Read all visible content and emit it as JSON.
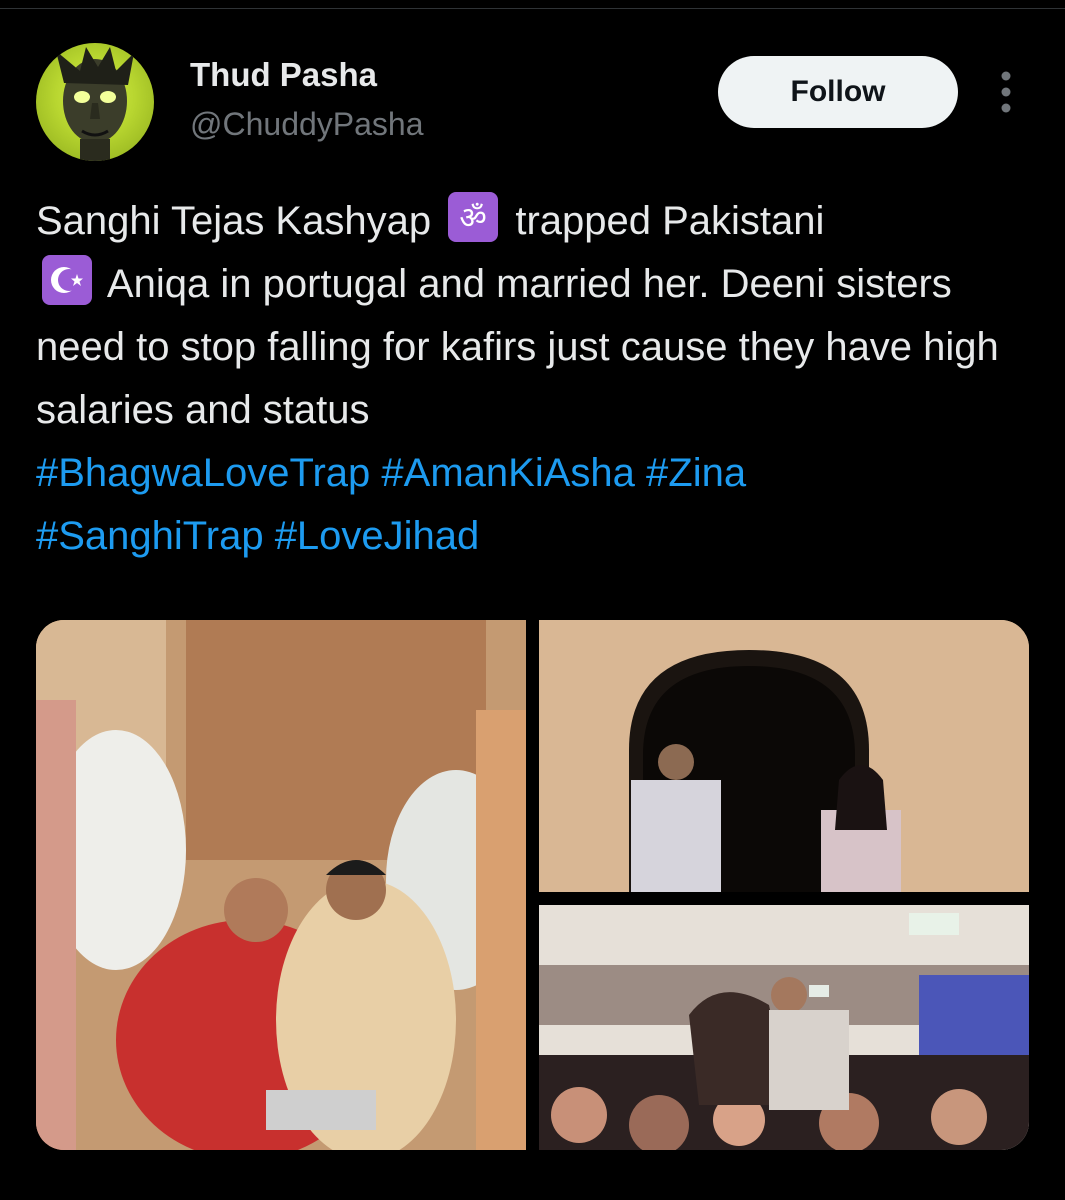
{
  "author": {
    "display_name": "Thud Pasha",
    "handle": "@ChuddyPasha"
  },
  "follow_label": "Follow",
  "tweet": {
    "text_part1": "Sanghi Tejas Kashyap ",
    "text_part2": " trapped Pakistani ",
    "text_part3": " Aniqa in portugal and married her. Deeni sisters need to stop falling for kafirs just cause they have high salaries and status ",
    "emoji_1": "om-emoji",
    "emoji_2": "star-and-crescent-emoji",
    "hashtags": [
      "#BhagwaLoveTrap",
      "#AmanKiAsha",
      "#Zina",
      "#SanghiTrap",
      "#LoveJihad"
    ]
  },
  "colors": {
    "background": "#000000",
    "text": "#e7e9ea",
    "secondary": "#71767b",
    "link": "#1d9bf0",
    "emoji_box": "#9b5cd6",
    "follow_bg": "#eff3f4"
  }
}
